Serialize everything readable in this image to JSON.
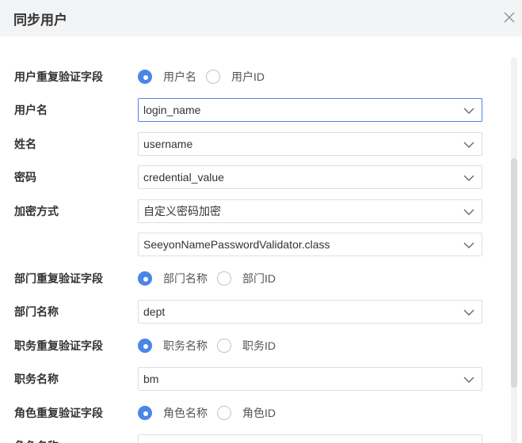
{
  "dialog": {
    "title": "同步用户"
  },
  "icons": {
    "close": "close-icon",
    "chevron": "chevron-down-icon"
  },
  "colors": {
    "accent": "#4a86e8",
    "header_bg": "#f3f4f6",
    "border": "#dcdfe6"
  },
  "form": {
    "user_dedup": {
      "label": "用户重复验证字段",
      "options": [
        "用户名",
        "用户ID"
      ],
      "selected": "用户名"
    },
    "username": {
      "label": "用户名",
      "value": "login_name"
    },
    "fullname": {
      "label": "姓名",
      "value": "username"
    },
    "password": {
      "label": "密码",
      "value": "credential_value"
    },
    "encryption": {
      "label": "加密方式",
      "value": "自定义密码加密",
      "class_value": "SeeyonNamePasswordValidator.class"
    },
    "dept_dedup": {
      "label": "部门重复验证字段",
      "options": [
        "部门名称",
        "部门ID"
      ],
      "selected": "部门名称"
    },
    "dept_name": {
      "label": "部门名称",
      "value": "dept"
    },
    "post_dedup": {
      "label": "职务重复验证字段",
      "options": [
        "职务名称",
        "职务ID"
      ],
      "selected": "职务名称"
    },
    "post_name": {
      "label": "职务名称",
      "value": "bm"
    },
    "role_dedup": {
      "label": "角色重复验证字段",
      "options": [
        "角色名称",
        "角色ID"
      ],
      "selected": "角色名称"
    },
    "role_name": {
      "label": "角色名称",
      "value": ""
    }
  }
}
